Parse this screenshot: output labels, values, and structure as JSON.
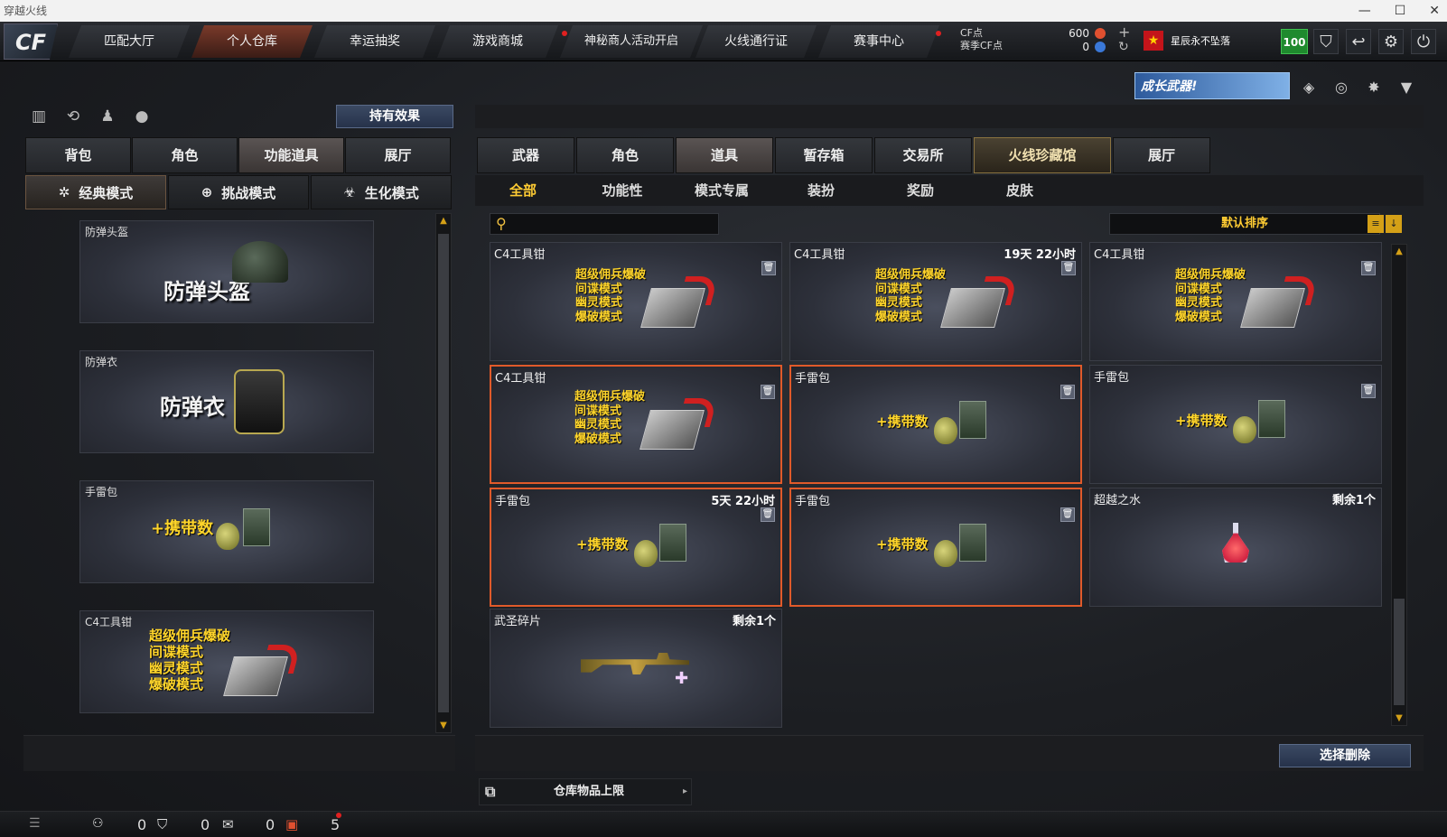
{
  "window": {
    "title": "穿越火线"
  },
  "topnav": {
    "logo": "CF",
    "tabs": [
      "匹配大厅",
      "个人仓库",
      "幸运抽奖",
      "游戏商城",
      "神秘商人活动开启",
      "火线通行证",
      "赛事中心"
    ],
    "cf_label": "CF点",
    "season_label": "赛季CF点",
    "cf_value": "600",
    "season_value": "0",
    "username": "星辰永不坠落",
    "level": "100"
  },
  "banner": {
    "text": "成长武器!"
  },
  "left": {
    "effects_button": "持有效果",
    "tabs": [
      "背包",
      "角色",
      "功能道具",
      "展厅"
    ],
    "modes": [
      "经典模式",
      "挑战模式",
      "生化模式"
    ],
    "items": [
      {
        "label": "防弹头盔",
        "big": "防弹头盔"
      },
      {
        "label": "防弹衣",
        "big": "防弹衣"
      },
      {
        "label": "手雷包",
        "big": "+携带数"
      },
      {
        "label": "C4工具钳",
        "lines": [
          "超级佣兵爆破",
          "间谍模式",
          "幽灵模式",
          "爆破模式"
        ]
      }
    ]
  },
  "right": {
    "tabs": [
      "武器",
      "角色",
      "道具",
      "暂存箱",
      "交易所",
      "火线珍藏馆",
      "展厅"
    ],
    "subtabs": [
      "全部",
      "功能性",
      "模式专属",
      "装扮",
      "奖励",
      "皮肤"
    ],
    "search_placeholder": "",
    "sort_label": "默认排序",
    "c4_lines": [
      "超级佣兵爆破",
      "间谍模式",
      "幽灵模式",
      "爆破模式"
    ],
    "grenade_text": "+携带数",
    "items": [
      {
        "label": "C4工具钳",
        "extra": ""
      },
      {
        "label": "C4工具钳",
        "extra": "19天 22小时"
      },
      {
        "label": "C4工具钳",
        "extra": ""
      },
      {
        "label": "C4工具钳",
        "extra": ""
      },
      {
        "label": "手雷包",
        "extra": ""
      },
      {
        "label": "手雷包",
        "extra": ""
      },
      {
        "label": "手雷包",
        "extra": "5天 22小时"
      },
      {
        "label": "手雷包",
        "extra": ""
      },
      {
        "label": "超越之水",
        "extra": "剩余1个"
      },
      {
        "label": "武圣碎片",
        "extra": "剩余1个"
      }
    ],
    "delete_button": "选择删除",
    "storage_label": "仓库物品上限"
  },
  "status": {
    "friends": "0",
    "guild": "0",
    "chat": "0",
    "gifts": "5"
  },
  "colors": {
    "accent_gold": "#ffcc33",
    "selected_border": "#e05a2a",
    "level_green": "#1f8a2e"
  }
}
